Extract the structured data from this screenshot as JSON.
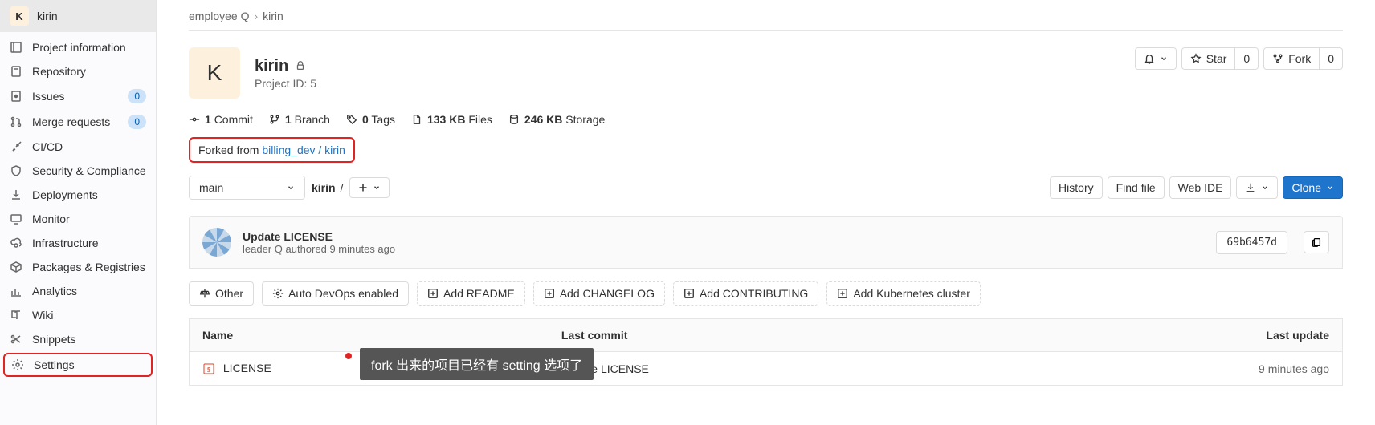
{
  "sidebar": {
    "project_letter": "K",
    "project_name": "kirin",
    "items": [
      {
        "label": "Project information"
      },
      {
        "label": "Repository"
      },
      {
        "label": "Issues",
        "badge": "0"
      },
      {
        "label": "Merge requests",
        "badge": "0"
      },
      {
        "label": "CI/CD"
      },
      {
        "label": "Security & Compliance"
      },
      {
        "label": "Deployments"
      },
      {
        "label": "Monitor"
      },
      {
        "label": "Infrastructure"
      },
      {
        "label": "Packages & Registries"
      },
      {
        "label": "Analytics"
      },
      {
        "label": "Wiki"
      },
      {
        "label": "Snippets"
      },
      {
        "label": "Settings"
      }
    ]
  },
  "breadcrumb": {
    "owner": "employee Q",
    "project": "kirin"
  },
  "project": {
    "letter": "K",
    "name": "kirin",
    "id_label": "Project ID: 5"
  },
  "actions": {
    "star_label": "Star",
    "star_count": "0",
    "fork_label": "Fork",
    "fork_count": "0"
  },
  "stats": {
    "commits_n": "1",
    "commits_l": "Commit",
    "branches_n": "1",
    "branches_l": "Branch",
    "tags_n": "0",
    "tags_l": "Tags",
    "files_n": "133 KB",
    "files_l": "Files",
    "storage_n": "246 KB",
    "storage_l": "Storage"
  },
  "forked": {
    "prefix": "Forked from ",
    "link": "billing_dev / kirin"
  },
  "toolbar": {
    "branch": "main",
    "path_project": "kirin",
    "history": "History",
    "find": "Find file",
    "webide": "Web IDE",
    "clone": "Clone"
  },
  "last_commit": {
    "title": "Update LICENSE",
    "author": "leader Q",
    "verb": "authored",
    "time": "9 minutes ago",
    "sha": "69b6457d"
  },
  "chips": {
    "other": "Other",
    "autodevops": "Auto DevOps enabled",
    "readme": "Add README",
    "changelog": "Add CHANGELOG",
    "contributing": "Add CONTRIBUTING",
    "k8s": "Add Kubernetes cluster"
  },
  "table": {
    "h_name": "Name",
    "h_commit": "Last commit",
    "h_update": "Last update",
    "rows": [
      {
        "name": "LICENSE",
        "commit": "Update LICENSE",
        "update": "9 minutes ago"
      }
    ]
  },
  "annotation": "fork 出来的项目已经有 setting 选项了"
}
